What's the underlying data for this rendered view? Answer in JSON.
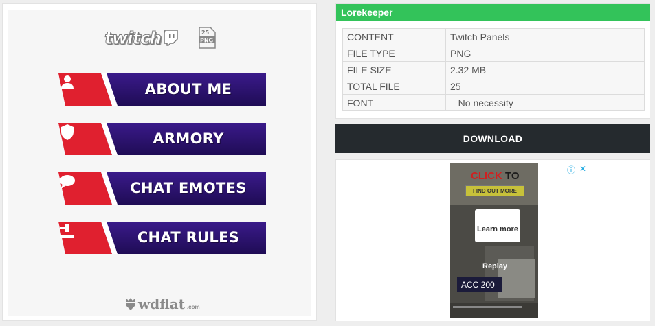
{
  "preview": {
    "brand_word": "twitch",
    "png_badge_count": "25",
    "png_badge_label": "PNG",
    "panels": [
      {
        "label": "ABOUT ME",
        "icon": "user-icon"
      },
      {
        "label": "ARMORY",
        "icon": "shield-icon"
      },
      {
        "label": "CHAT EMOTES",
        "icon": "chat-bubble-icon"
      },
      {
        "label": "CHAT RULES",
        "icon": "gavel-icon"
      }
    ],
    "watermark": "wdflat",
    "watermark_suffix": ".com"
  },
  "info": {
    "title": "Lorekeeper",
    "rows": [
      {
        "key": "CONTENT",
        "value": "Twitch Panels"
      },
      {
        "key": "FILE TYPE",
        "value": "PNG"
      },
      {
        "key": "FILE SIZE",
        "value": "2.32 MB"
      },
      {
        "key": "TOTAL FILE",
        "value": "25"
      },
      {
        "key": "FONT",
        "value": "– No necessity"
      }
    ]
  },
  "download": {
    "label": "DOWNLOAD"
  },
  "ad": {
    "click_to_a": "CLICK",
    "click_to_b": " TO",
    "find_text": "FIND OUT MORE",
    "learn_more": "Learn more",
    "replay": "Replay",
    "acc_text": "ACC 200",
    "info_icon": "ⓘ",
    "close_icon": "✕"
  },
  "colors": {
    "header_green": "#33c35a",
    "download_bg": "#252a2e",
    "panel_red": "#e0202f",
    "panel_purple": "#2d1470"
  }
}
